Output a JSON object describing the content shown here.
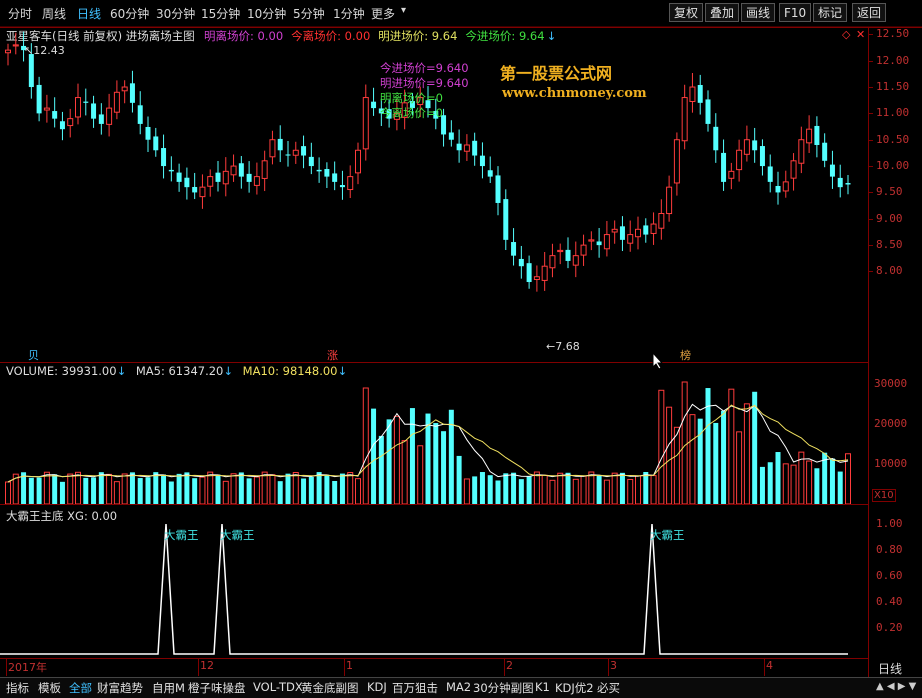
{
  "toolbar": {
    "periods": [
      "分时",
      "周线",
      "日线",
      "60分钟",
      "30分钟",
      "15分钟",
      "10分钟",
      "5分钟",
      "1分钟",
      "更多"
    ],
    "active_period": "日线",
    "more_arrow": "▾",
    "buttons": [
      "复权",
      "叠加",
      "画线",
      "F10",
      "标记",
      "返回"
    ]
  },
  "main": {
    "title": "亚星客车(日线 前复权) 进场离场主图",
    "fields": [
      {
        "label": "明离场价: 0.00",
        "color": "#d040d0"
      },
      {
        "label": "今离场价: 0.00",
        "color": "#ff3030"
      },
      {
        "label": "明进场价: 9.64",
        "color": "#e0e060"
      },
      {
        "label": "今进场价: 9.64",
        "color": "#40e040"
      }
    ],
    "high_label": "12.43",
    "low_label": "7.68",
    "overlay_lines": [
      {
        "text": "今进场价=9.640",
        "color": "#d040d0"
      },
      {
        "text": "明进场价=9.640",
        "color": "#d040d0"
      },
      {
        "text": "明离场价=0",
        "color": "#40e040"
      },
      {
        "text": "今离场价=0",
        "color": "#40e040"
      }
    ],
    "watermark_cn": "第一股票公式网",
    "watermark_url": "www.chnmoney.com",
    "markers": [
      {
        "text": "贝",
        "color": "#40c0ff"
      },
      {
        "text": "涨",
        "color": "#ff4040"
      },
      {
        "text": "榜",
        "color": "#e0a040"
      }
    ],
    "yaxis": [
      "12.50",
      "12.00",
      "11.50",
      "11.00",
      "10.50",
      "10.00",
      "9.50",
      "9.00",
      "8.50",
      "8.00"
    ]
  },
  "volume": {
    "vol": "VOLUME: 39931.00",
    "ma5": "MA5: 61347.20",
    "ma10": "MA10: 98148.00",
    "yaxis": [
      "30000",
      "20000",
      "10000"
    ],
    "unit": "X10"
  },
  "indicator": {
    "title": "大霸王主底 XG: 0.00",
    "peak_label": "大霸王",
    "yaxis": [
      "1.00",
      "0.80",
      "0.60",
      "0.40",
      "0.20"
    ]
  },
  "xaxis": [
    "2017年",
    "12",
    "1",
    "2",
    "3",
    "4"
  ],
  "period_label": "日线",
  "bottom_tabs": [
    "指标",
    "模板",
    "全部",
    "财富趋势",
    "自用M",
    "橙子味操盘",
    "VOL-TDX",
    "黄金底副图",
    "KDJ",
    "百万狙击",
    "MA2",
    "30分钟副图",
    "K1",
    "KDJ优2",
    "必买"
  ],
  "active_tab": "全部",
  "colors": {
    "up": "#ff3c3c",
    "down": "#54ffff",
    "frame": "#800000",
    "accent": "#40c0ff"
  }
}
